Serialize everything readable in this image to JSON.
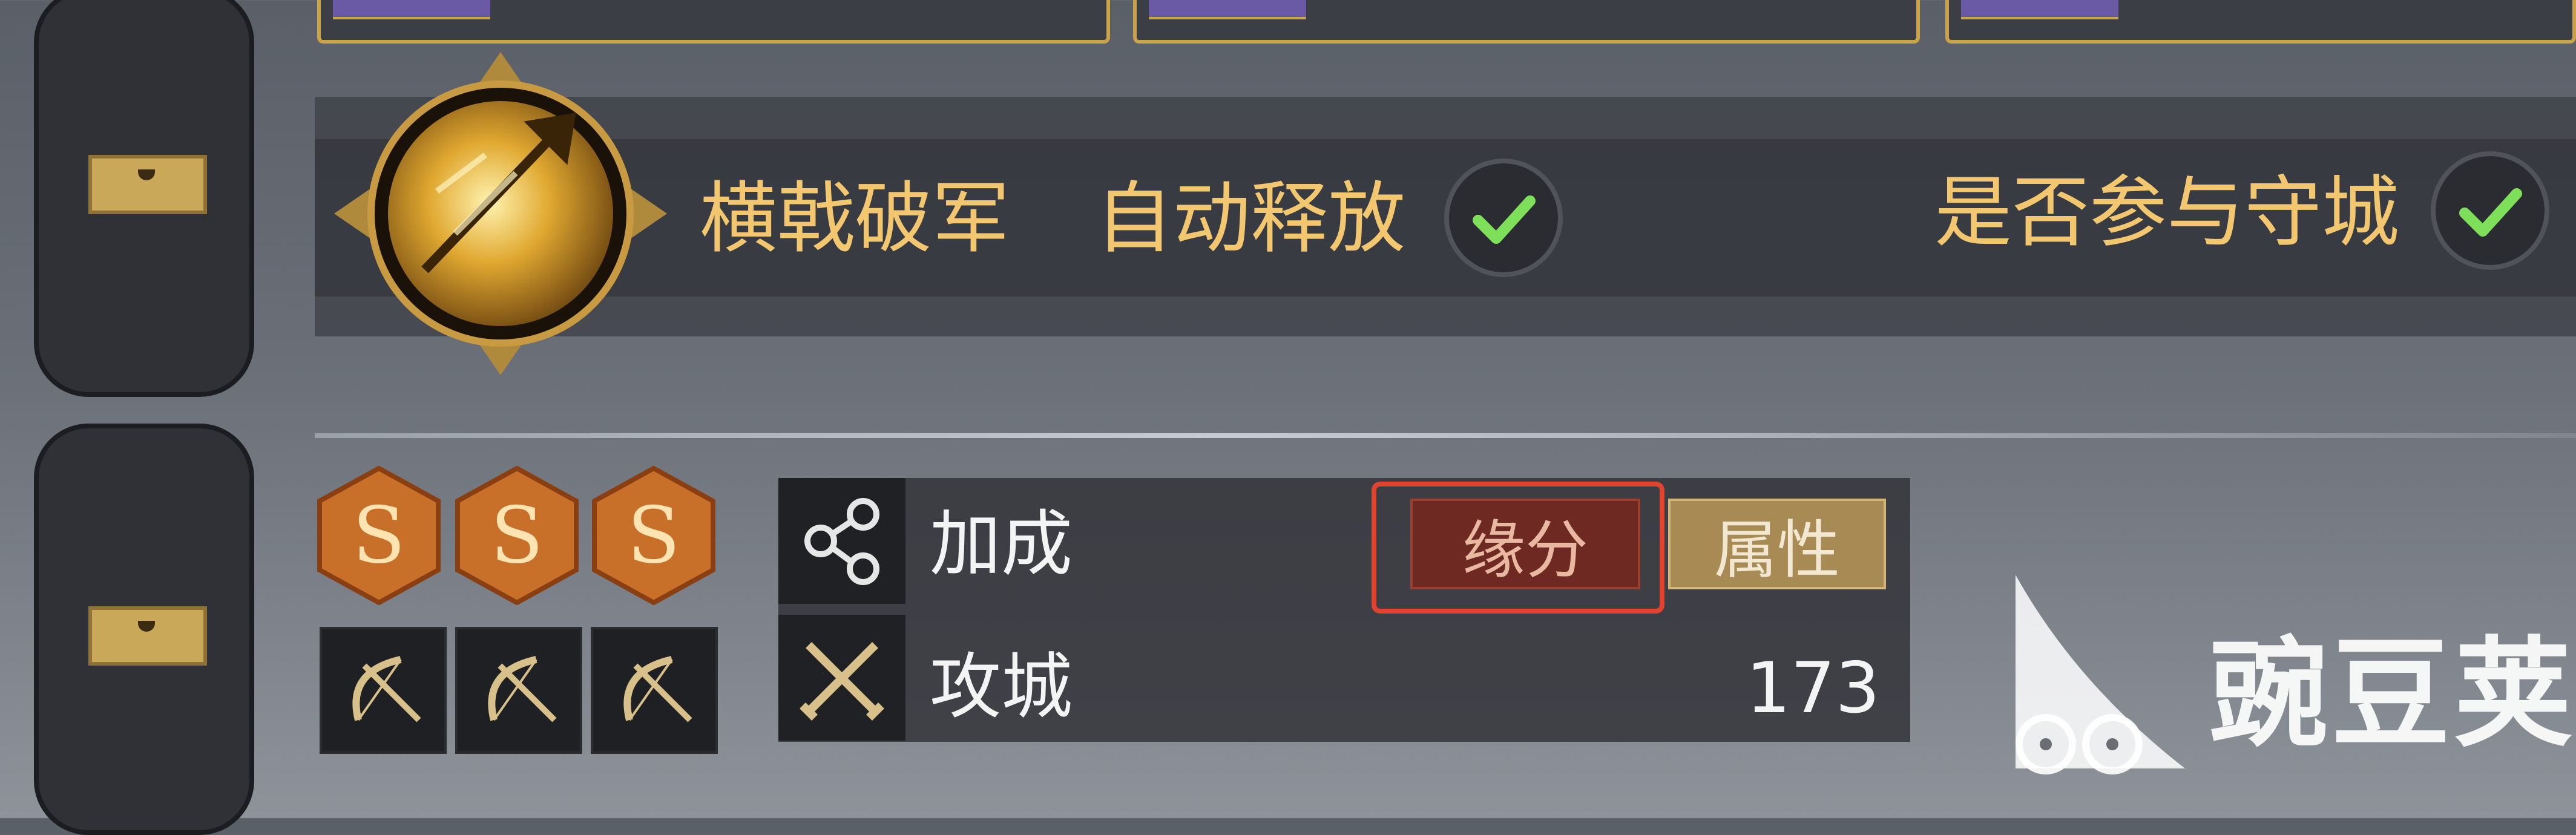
{
  "skill": {
    "name": "横戟破军",
    "auto_release_label": "自动释放",
    "auto_release_checked": true,
    "defend_city_label": "是否参与守城",
    "defend_city_checked": true
  },
  "tiers": [
    "S",
    "S",
    "S"
  ],
  "unit_types": [
    "bow-icon",
    "bow-icon",
    "bow-icon"
  ],
  "attributes": {
    "bonus_label": "加成",
    "tabs": [
      "缘分",
      "属性"
    ],
    "selected_tab": "缘分",
    "siege_label": "攻城",
    "siege_value": "173"
  },
  "watermark": "豌豆荚",
  "colors": {
    "gold_text": "#f3c770",
    "check_green": "#7ee05a",
    "tier_orange": "#c8702a",
    "highlight_red": "#e0432e"
  }
}
